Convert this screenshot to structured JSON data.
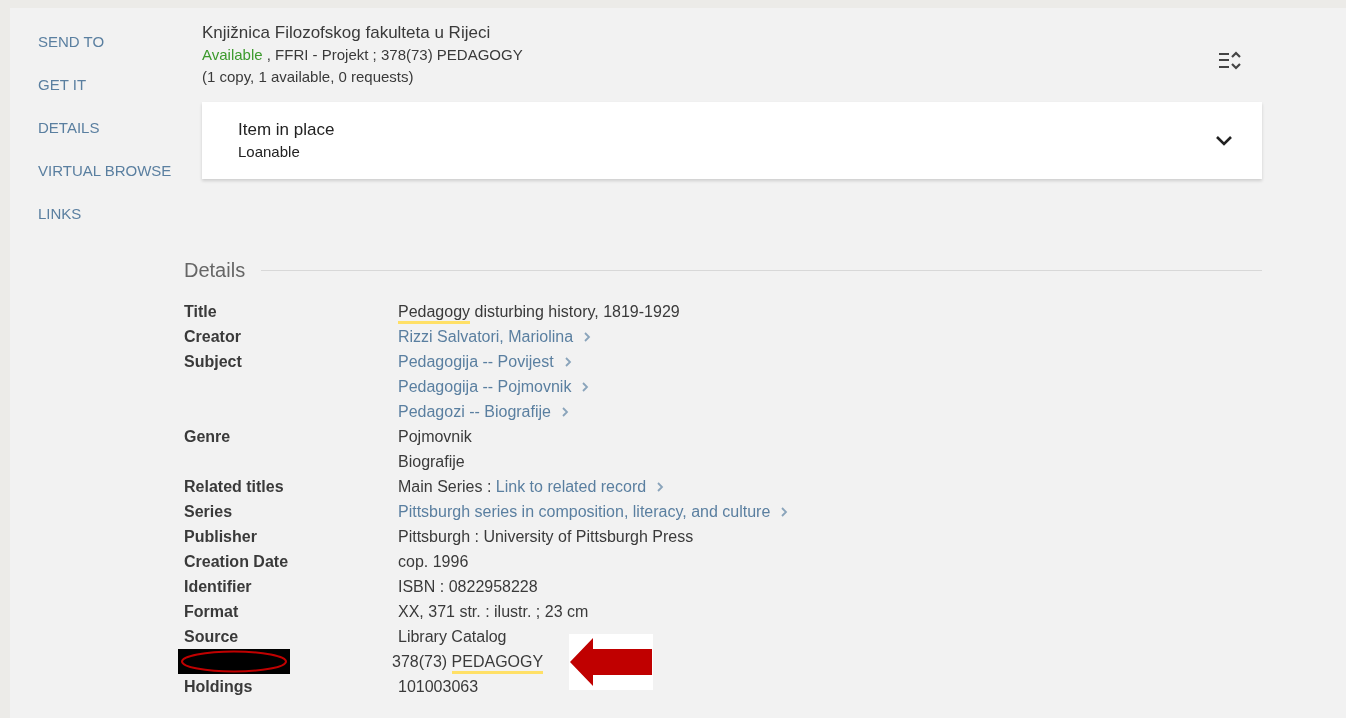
{
  "sidebar": {
    "items": [
      {
        "label": "SEND TO"
      },
      {
        "label": "GET IT"
      },
      {
        "label": "DETAILS"
      },
      {
        "label": "VIRTUAL BROWSE"
      },
      {
        "label": "LINKS"
      }
    ]
  },
  "location": {
    "library": "Knjižnica Filozofskog fakulteta u Rijeci",
    "status": "Available",
    "details": ", FFRI - Projekt ; 378(73) PEDAGOGY",
    "counts": "(1 copy, 1 available, 0 requests)"
  },
  "item": {
    "title": "Item in place",
    "policy": "Loanable",
    "expanded": false
  },
  "details": {
    "heading": "Details",
    "fields": [
      {
        "label": "Title",
        "lines": [
          [
            {
              "kind": "text",
              "text": "Pedagogy",
              "highlight": true
            },
            {
              "kind": "text",
              "text": " disturbing history, 1819-1929"
            }
          ]
        ]
      },
      {
        "label": "Creator",
        "lines": [
          [
            {
              "kind": "link",
              "text": "Rizzi Salvatori, Mariolina"
            }
          ]
        ]
      },
      {
        "label": "Subject",
        "lines": [
          [
            {
              "kind": "link",
              "text": "Pedagogija -- Povijest"
            }
          ],
          [
            {
              "kind": "link",
              "text": "Pedagogija -- Pojmovnik"
            }
          ],
          [
            {
              "kind": "link",
              "text": "Pedagozi -- Biografije"
            }
          ]
        ]
      },
      {
        "label": "Genre",
        "lines": [
          [
            {
              "kind": "text",
              "text": "Pojmovnik"
            }
          ],
          [
            {
              "kind": "text",
              "text": "Biografije"
            }
          ]
        ]
      },
      {
        "label": "Related titles",
        "lines": [
          [
            {
              "kind": "text",
              "text": "Main Series : "
            },
            {
              "kind": "link",
              "text": "Link to related record"
            }
          ]
        ]
      },
      {
        "label": "Series",
        "lines": [
          [
            {
              "kind": "link",
              "text": "Pittsburgh series in composition, literacy, and culture"
            }
          ]
        ]
      },
      {
        "label": "Publisher",
        "lines": [
          [
            {
              "kind": "text",
              "text": "Pittsburgh : University of Pittsburgh Press"
            }
          ]
        ]
      },
      {
        "label": "Creation Date",
        "lines": [
          [
            {
              "kind": "text",
              "text": "cop. 1996"
            }
          ]
        ]
      },
      {
        "label": "Identifier",
        "lines": [
          [
            {
              "kind": "text",
              "text": "ISBN : 0822958228"
            }
          ]
        ]
      },
      {
        "label": "Format",
        "lines": [
          [
            {
              "kind": "text",
              "text": "XX, 371 str. : ilustr. ; 23 cm"
            }
          ]
        ]
      },
      {
        "label": "Source",
        "lines": [
          [
            {
              "kind": "text",
              "text": "Library Catalog"
            }
          ]
        ]
      },
      {
        "redacted": true,
        "arrow": true,
        "lines": [
          [
            {
              "kind": "text",
              "text": "378(73) "
            },
            {
              "kind": "text",
              "text": "PEDAGOGY",
              "highlight": true
            }
          ]
        ]
      },
      {
        "label": "Holdings",
        "lines": [
          [
            {
              "kind": "text",
              "text": "101003063"
            }
          ]
        ]
      }
    ]
  }
}
